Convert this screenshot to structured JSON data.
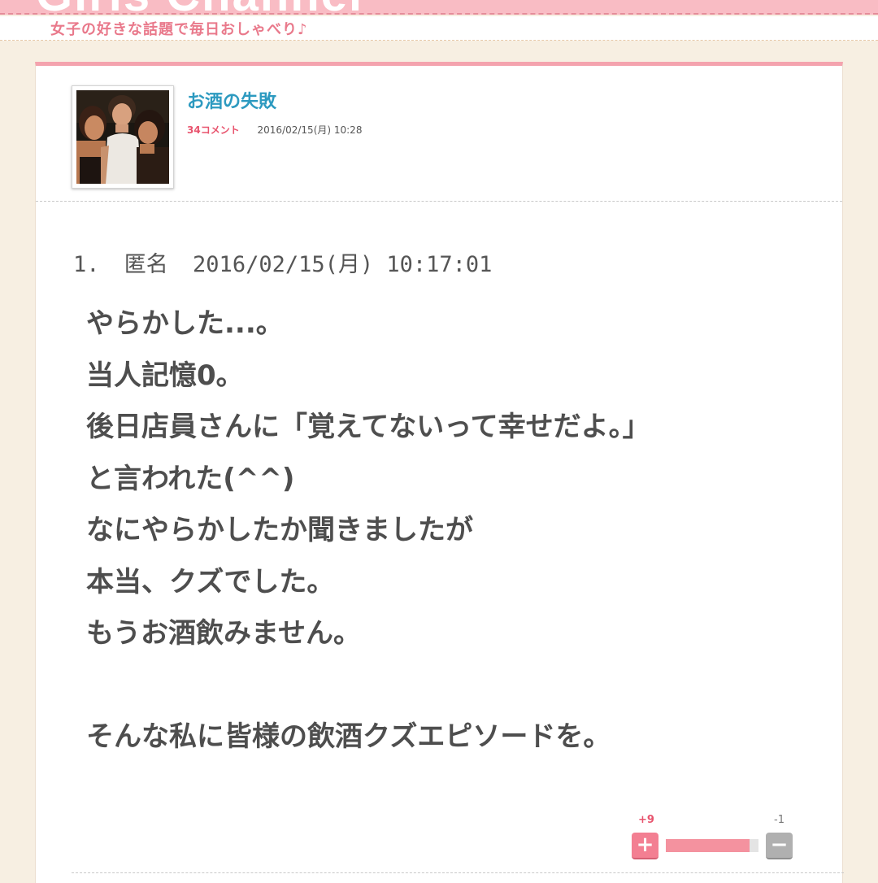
{
  "header": {
    "logo": "Girls Channel",
    "tagline": "女子の好きな話題で毎日おしゃべり♪"
  },
  "topic": {
    "title": "お酒の失敗",
    "comment_count": "34コメント",
    "date": "2016/02/15(月) 10:28",
    "thumbnail": "topic-photo"
  },
  "comment": {
    "number": "1.",
    "author": "匿名",
    "datetime": "2016/02/15(月) 10:17:01",
    "lines": [
      "やらかした...。",
      "当人記憶0。",
      "後日店員さんに「覚えてないって幸せだよ。」",
      "と言われた(^^)",
      "なにやらかしたか聞きましたが",
      "本当、クズでした。",
      "もうお酒飲みません。",
      "",
      "そんな私に皆様の飲酒クズエピソードを。"
    ],
    "votes": {
      "plus": "+9",
      "minus": "-1",
      "plus_ratio": 0.9,
      "plus_icon": "+",
      "minus_icon": "−"
    }
  },
  "colors": {
    "accent_pink": "#f4a3ae",
    "title_blue": "#2d9ac0",
    "count_red": "#e8546e",
    "background": "#f7efe2"
  }
}
